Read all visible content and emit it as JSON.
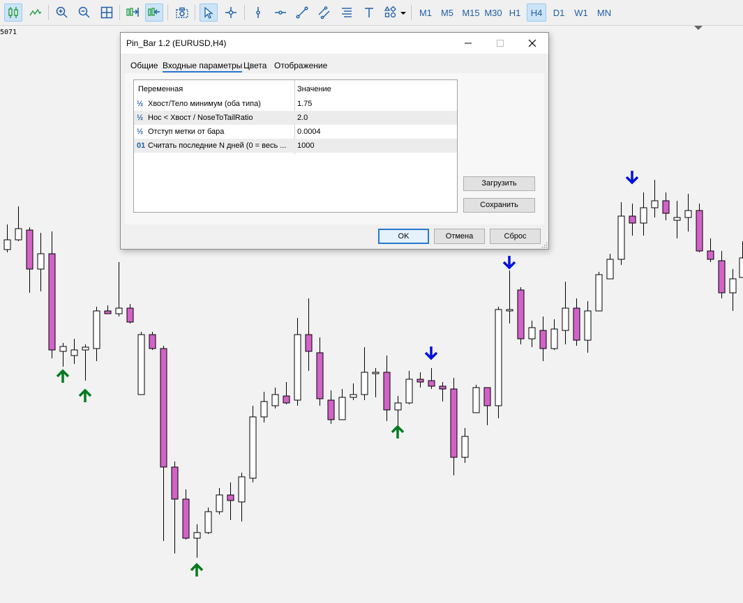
{
  "toolbar": {
    "timeframes": [
      {
        "label": "M1",
        "active": false
      },
      {
        "label": "M5",
        "active": false
      },
      {
        "label": "M15",
        "active": false
      },
      {
        "label": "M30",
        "active": false
      },
      {
        "label": "H1",
        "active": false
      },
      {
        "label": "H4",
        "active": true
      },
      {
        "label": "D1",
        "active": false
      },
      {
        "label": "W1",
        "active": false
      },
      {
        "label": "MN",
        "active": false
      }
    ],
    "icons": [
      "bar-chart-icon",
      "line-chart-icon",
      "zoom-in-icon",
      "zoom-out-icon",
      "grid-icon",
      "chart-shift-icon",
      "autoscroll-icon",
      "screenshot-icon",
      "cursor-icon",
      "crosshair-icon",
      "vertical-line-icon",
      "horizontal-line-icon",
      "trendline-icon",
      "channel-icon",
      "fibonacci-icon",
      "text-icon",
      "shapes-icon"
    ]
  },
  "chart": {
    "price_label": "5071",
    "colors": {
      "bear": "#d262c8",
      "bull": "#ffffff",
      "outline": "#000000",
      "up_arrow": "#007a1e",
      "down_arrow": "#0011dd"
    }
  },
  "dialog": {
    "title": "Pin_Bar 1.2 (EURUSD,H4)",
    "tabs": [
      "Общие",
      "Входные параметры",
      "Цвета",
      "Отображение"
    ],
    "active_tab": 1,
    "table": {
      "headers": [
        "Переменная",
        "Значение"
      ],
      "rows": [
        {
          "icon": "½",
          "name": "Хвост/Тело минимум (оба типа)",
          "value": "1.75"
        },
        {
          "icon": "½",
          "name": "Нос < Хвост / NoseToTailRatio",
          "value": "2.0"
        },
        {
          "icon": "½",
          "name": "Отступ метки от бара",
          "value": "0.0004"
        },
        {
          "icon": "01",
          "name": "Считать последние N дней (0 = весь ...",
          "value": "1000"
        }
      ]
    },
    "buttons": {
      "load": "Загрузить",
      "save": "Сохранить",
      "ok": "OK",
      "cancel": "Отмена",
      "reset": "Сброс"
    }
  }
}
